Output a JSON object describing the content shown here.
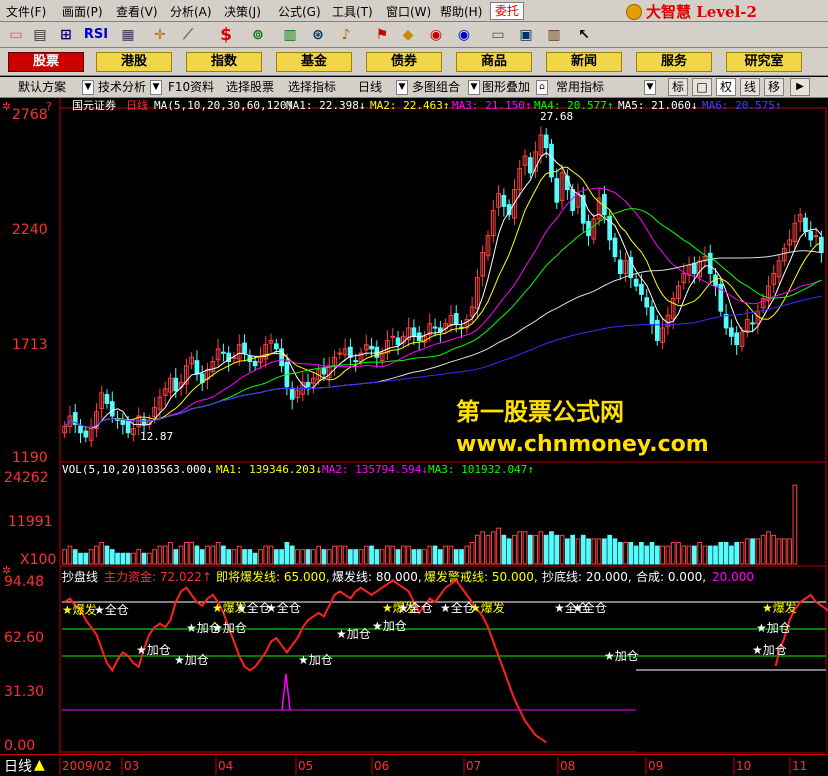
{
  "menu": [
    "文件(F)",
    "画面(P)",
    "查看(V)",
    "分析(A)",
    "决策(J)",
    "公式(G)",
    "工具(T)",
    "窗口(W)",
    "帮助(H)"
  ],
  "entrust": "委托",
  "brand": "大智慧 Level-2",
  "toolbar_icons": [
    "folder-icon",
    "print-icon",
    "line-chart-icon",
    "rsi-icon",
    "grid-icon",
    "crosshair-icon",
    "ruler-icon",
    "dollar-icon",
    "glasses-icon",
    "bars-icon",
    "binoculars-icon",
    "bell-icon",
    "flag-icon",
    "diamond-icon",
    "circle-e-icon",
    "circle-d-icon",
    "notes-icon",
    "window-icon",
    "books-icon",
    "help-pointer-icon"
  ],
  "toolbar_rsi": "RSI",
  "toolbar_s": "$",
  "nav": {
    "items": [
      "股票",
      "港股",
      "指数",
      "基金",
      "债券",
      "商品",
      "新闻",
      "服务",
      "研究室"
    ],
    "active": 0
  },
  "subbar": {
    "items": [
      "默认方案",
      "技术分析",
      "F10资料",
      "选择股票",
      "选择指标",
      "日线",
      "多图组合",
      "图形叠加",
      "常用指标"
    ],
    "tabs": [
      "标",
      "□",
      "权",
      "线",
      "移"
    ]
  },
  "main": {
    "title_stock": "国元证券",
    "title_period": "日线",
    "ma_legend": "MA(5,10,20,30,60,120)",
    "ma1": "MA1: 22.398↓",
    "ma2": "MA2: 22.463↑",
    "ma3": "MA3: 21.150↑",
    "ma4": "MA4: 20.577↑",
    "ma5": "MA5: 21.060↓",
    "ma6": "MA6: 20.575↑",
    "ylabels": [
      "2768",
      "2240",
      "1713",
      "1190"
    ],
    "high_label": "27.68",
    "low_label": "12.87"
  },
  "vol": {
    "legend": "VOL(5,10,20)",
    "val": "103563.000↓",
    "ma1": "MA1: 139346.203↓",
    "ma2": "MA2: 135794.594↓",
    "ma3": "MA3: 101932.047↑",
    "ylabels": [
      "24262",
      "11991",
      "X100"
    ]
  },
  "ind": {
    "name": "抄盘线",
    "zl": "主力资金: 72.022↑",
    "jj": "即将爆发线: 65.000,",
    "bf": "爆发线: 80.000,",
    "bfjj": "爆发警戒线: 50.000,",
    "cd": "抄底线: 20.000,",
    "hc": "合成: 0.000,",
    "hc_val": "20.000",
    "ylabels": [
      "94.48",
      "62.60",
      "31.30",
      "0.00"
    ],
    "star_labels": {
      "full": "全仓",
      "add": "加仓",
      "explode": "爆发"
    }
  },
  "status": {
    "period": "日线"
  },
  "xaxis": [
    "2009/02",
    "03",
    "04",
    "05",
    "06",
    "07",
    "08",
    "09",
    "10",
    "11"
  ],
  "watermark": {
    "line1": "第一股票公式网",
    "line2": "www.chnmoney.com"
  },
  "colors": {
    "up": "#ff4040",
    "down": "#54fcfc",
    "ma1": "#ffffff",
    "ma2": "#ffff00",
    "ma3": "#ff00ff",
    "ma4": "#00ff00",
    "ma5": "#e0e0e0",
    "ma6": "#3030ff"
  },
  "chart_data": {
    "type": "candlestick",
    "y_range": [
      11.9,
      28.5
    ],
    "close_series": [
      13.5,
      14.0,
      13.6,
      13.2,
      13.0,
      13.4,
      14.2,
      15.1,
      14.6,
      14.0,
      13.8,
      13.6,
      13.2,
      13.4,
      14.0,
      13.6,
      13.8,
      14.4,
      14.9,
      15.3,
      15.8,
      15.2,
      15.6,
      16.4,
      16.8,
      16.0,
      15.6,
      16.2,
      16.6,
      17.2,
      17.0,
      16.6,
      16.8,
      17.4,
      17.0,
      16.6,
      16.4,
      16.8,
      17.4,
      17.6,
      17.2,
      16.4,
      15.4,
      14.8,
      15.2,
      15.6,
      15.4,
      15.8,
      16.2,
      16.0,
      16.4,
      16.8,
      17.0,
      17.2,
      16.8,
      16.6,
      17.0,
      17.4,
      17.2,
      16.8,
      17.0,
      17.6,
      17.8,
      17.4,
      17.8,
      18.2,
      17.8,
      17.6,
      17.8,
      18.4,
      18.2,
      18.0,
      18.4,
      18.8,
      18.4,
      18.2,
      18.6,
      19.2,
      20.6,
      21.8,
      22.6,
      23.8,
      24.6,
      24.0,
      23.6,
      24.8,
      25.8,
      26.4,
      25.6,
      26.6,
      27.4,
      26.8,
      25.4,
      24.2,
      25.6,
      24.8,
      23.8,
      24.6,
      23.2,
      22.6,
      23.4,
      24.4,
      23.6,
      22.4,
      21.6,
      20.8,
      21.4,
      20.6,
      20.2,
      19.8,
      19.2,
      18.4,
      17.6,
      18.2,
      18.8,
      19.6,
      20.2,
      20.8,
      21.2,
      20.8,
      21.4,
      21.6,
      20.8,
      20.2,
      19.0,
      18.2,
      17.8,
      17.4,
      18.0,
      18.6,
      18.4,
      19.0,
      19.6,
      20.2,
      20.8,
      21.4,
      22.0,
      22.4,
      23.2,
      23.6,
      22.8,
      22.4,
      22.6,
      21.8
    ],
    "vol_series": [
      4,
      5,
      4,
      3,
      3,
      4,
      5,
      6,
      5,
      4,
      3,
      3,
      3,
      3,
      4,
      3,
      3,
      4,
      5,
      5,
      6,
      4,
      5,
      6,
      6,
      5,
      4,
      5,
      5,
      6,
      5,
      4,
      4,
      5,
      4,
      4,
      3,
      4,
      5,
      5,
      4,
      4,
      6,
      5,
      4,
      4,
      4,
      4,
      5,
      4,
      4,
      5,
      5,
      5,
      4,
      4,
      4,
      5,
      5,
      4,
      4,
      5,
      5,
      4,
      5,
      5,
      4,
      4,
      4,
      5,
      5,
      4,
      5,
      5,
      4,
      4,
      5,
      6,
      8,
      9,
      8,
      9,
      10,
      8,
      7,
      8,
      9,
      9,
      8,
      8,
      9,
      8,
      9,
      8,
      8,
      7,
      8,
      7,
      8,
      7,
      7,
      7,
      7,
      8,
      7,
      6,
      6,
      6,
      5,
      6,
      5,
      6,
      5,
      5,
      5,
      6,
      6,
      5,
      5,
      5,
      6,
      5,
      5,
      5,
      6,
      6,
      5,
      6,
      6,
      7,
      7,
      7,
      8,
      9,
      8,
      7,
      7,
      7,
      22
    ],
    "osc_series": [
      80,
      82,
      78,
      76,
      70,
      66,
      62,
      54,
      46,
      42,
      48,
      52,
      50,
      46,
      44,
      54,
      62,
      66,
      68,
      66,
      70,
      80,
      86,
      88,
      84,
      80,
      78,
      82,
      84,
      80,
      74,
      66,
      58,
      50,
      44,
      42,
      44,
      48,
      52,
      58,
      60,
      56,
      52,
      56,
      60,
      66,
      70,
      72,
      74,
      72,
      78,
      84,
      86,
      84,
      82,
      86,
      88,
      86,
      84,
      86,
      88,
      90,
      92,
      90,
      88,
      86,
      80,
      74,
      78,
      82,
      80,
      84,
      88,
      90,
      92,
      88,
      84,
      80,
      76,
      72,
      66,
      58,
      50,
      42,
      34,
      26,
      20,
      14,
      10,
      6,
      4,
      2,
      0,
      0,
      0,
      0,
      0,
      0,
      0,
      0,
      0,
      0,
      0,
      0,
      0,
      0,
      0,
      0,
      0,
      0,
      0,
      0,
      0,
      0,
      0,
      0,
      0,
      0,
      0,
      0,
      0,
      0,
      0,
      0,
      0,
      0,
      0,
      0,
      0,
      0,
      0,
      0,
      0,
      0,
      40,
      52,
      60,
      70,
      76,
      80,
      82,
      84,
      80,
      78,
      76,
      74,
      72
    ],
    "osc_range": [
      0,
      94.48
    ],
    "osc_levels": [
      80,
      65,
      50,
      20
    ]
  }
}
